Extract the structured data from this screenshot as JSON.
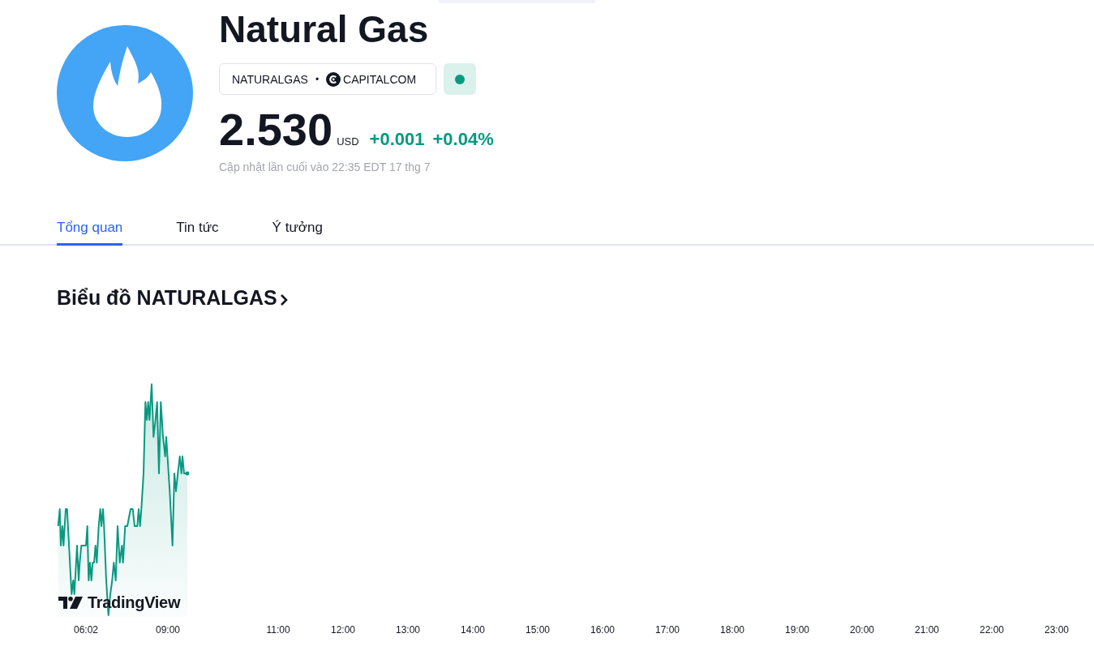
{
  "instrument": {
    "name": "Natural Gas",
    "symbol": "NATURALGAS",
    "separator": "•",
    "exchange": "CAPITALCOM"
  },
  "market_status": {
    "open": true
  },
  "quote": {
    "price": "2.530",
    "currency": "USD",
    "change": "+0.001",
    "change_percent": "+0.04%",
    "updated": "Cập nhật lần cuối vào 22:35 EDT 17 thg 7"
  },
  "tabs": [
    {
      "label": "Tổng quan",
      "selected": true
    },
    {
      "label": "Tin tức",
      "selected": false
    },
    {
      "label": "Ý tưởng",
      "selected": false
    }
  ],
  "chart": {
    "title": "Biểu đồ NATURALGAS",
    "attribution": "TradingView",
    "time_labels": [
      "06:02",
      "09:00",
      "11:00",
      "12:00",
      "13:00",
      "14:00",
      "15:00",
      "16:00",
      "17:00",
      "18:00",
      "19:00",
      "20:00",
      "21:00",
      "22:00",
      "23:00"
    ]
  }
}
